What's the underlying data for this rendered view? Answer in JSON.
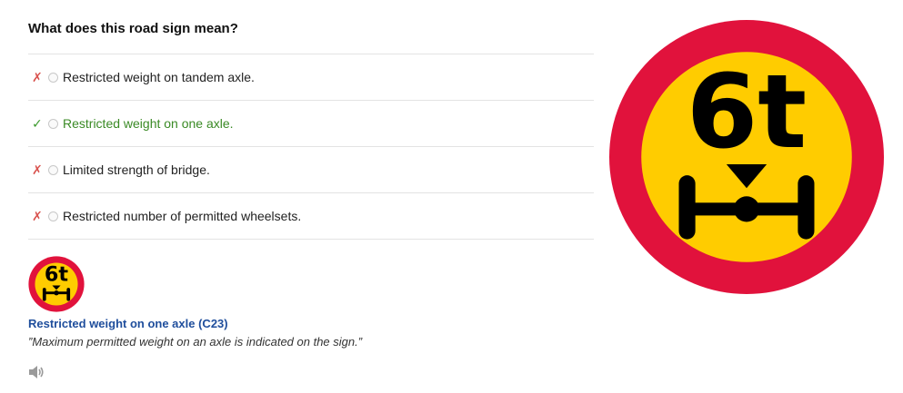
{
  "question": "What does this road sign mean?",
  "answers": [
    {
      "mark": "✗",
      "text": "Restricted weight on tandem axle."
    },
    {
      "mark": "✓",
      "text": "Restricted weight on one axle."
    },
    {
      "mark": "✗",
      "text": "Limited strength of bridge."
    },
    {
      "mark": "✗",
      "text": "Restricted number of permitted wheelsets."
    }
  ],
  "correct_answer_index": 1,
  "sign": {
    "text": "6t",
    "icon": "axle-weight-limit-sign",
    "colors": {
      "ring": "#e1123c",
      "fill": "#ffcc00",
      "symbol": "#000000"
    }
  },
  "explanation": {
    "title": "Restricted weight on one axle (C23)",
    "quote": "”Maximum permitted weight on an axle is indicated on the sign.”",
    "audio_icon": "speaker-icon"
  },
  "colors": {
    "correct_text": "#3a8a25",
    "wrong_mark": "#d9534f",
    "link_title": "#1f4e9c"
  }
}
